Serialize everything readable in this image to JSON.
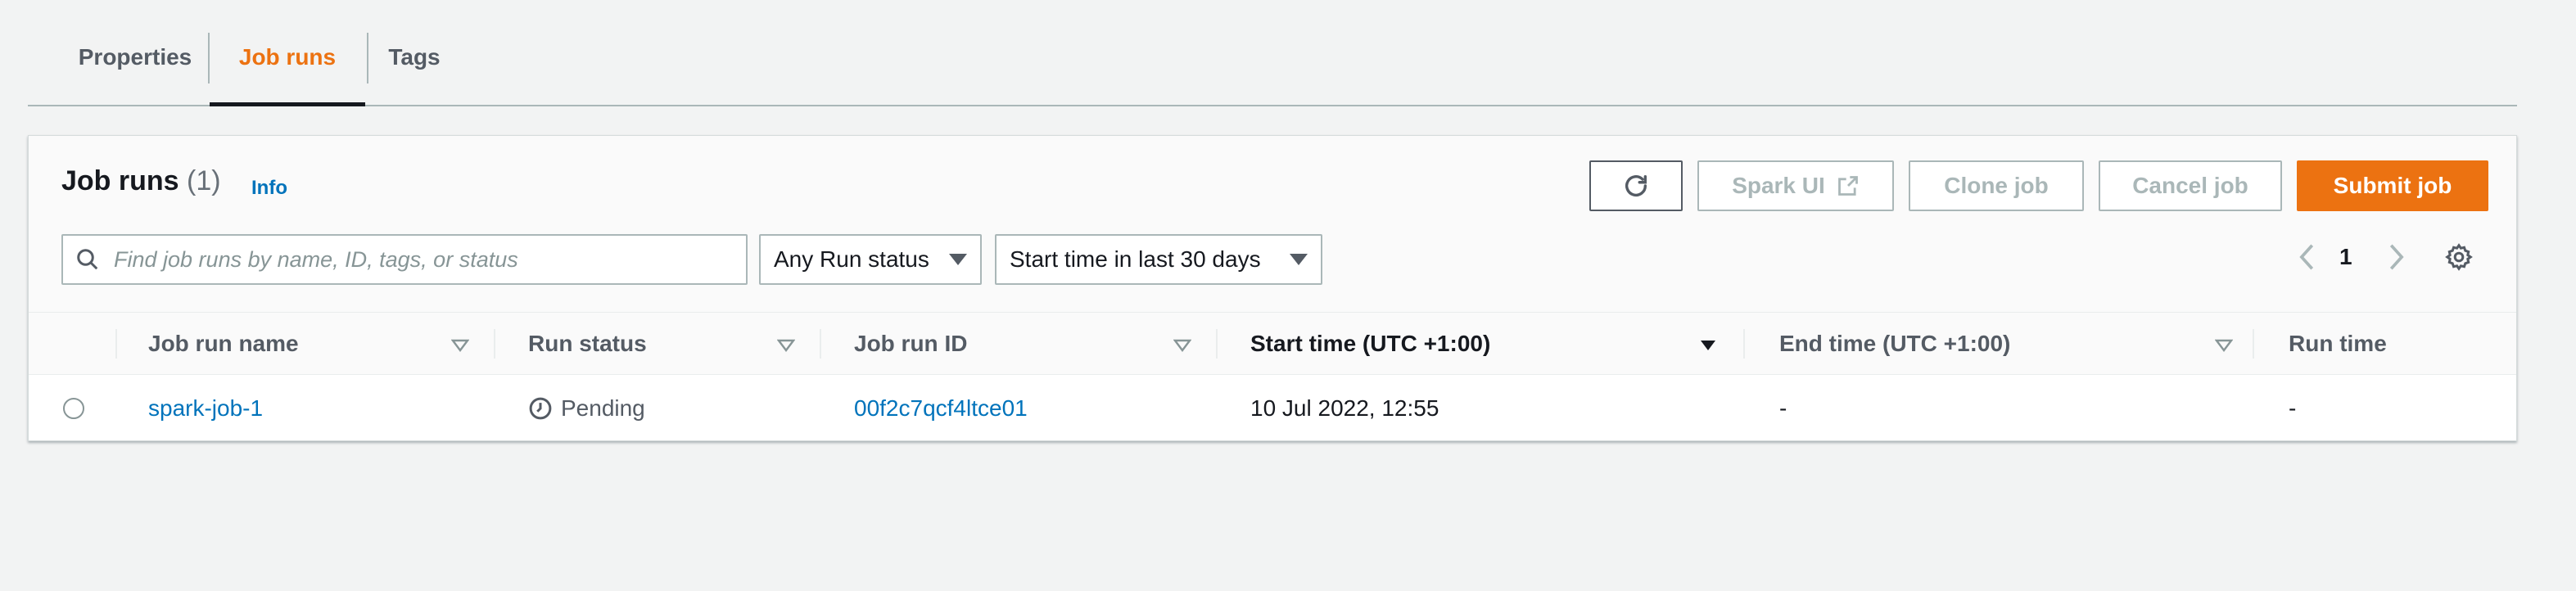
{
  "tabs": [
    {
      "label": "Properties"
    },
    {
      "label": "Job runs"
    },
    {
      "label": "Tags"
    }
  ],
  "panel": {
    "title": "Job runs",
    "count": "(1)",
    "info_label": "Info"
  },
  "actions": {
    "spark_ui": "Spark UI",
    "clone_job": "Clone job",
    "cancel_job": "Cancel job",
    "submit_job": "Submit job"
  },
  "filters": {
    "search_placeholder": "Find job runs by name, ID, tags, or status",
    "run_status": "Any Run status",
    "start_time": "Start time in last 30 days"
  },
  "pagination": {
    "current_page": "1"
  },
  "table": {
    "columns": [
      "Job run name",
      "Run status",
      "Job run ID",
      "Start time (UTC +1:00)",
      "End time (UTC +1:00)",
      "Run time"
    ],
    "rows": [
      {
        "name": "spark-job-1",
        "status": "Pending",
        "run_id": "00f2c7qcf4ltce01",
        "start_time": "10 Jul 2022, 12:55",
        "end_time": "-",
        "run_time": "-"
      }
    ]
  },
  "colors": {
    "accent": "#ec7211",
    "link": "#0073bb",
    "text": "#16191f",
    "muted": "#545b64"
  }
}
